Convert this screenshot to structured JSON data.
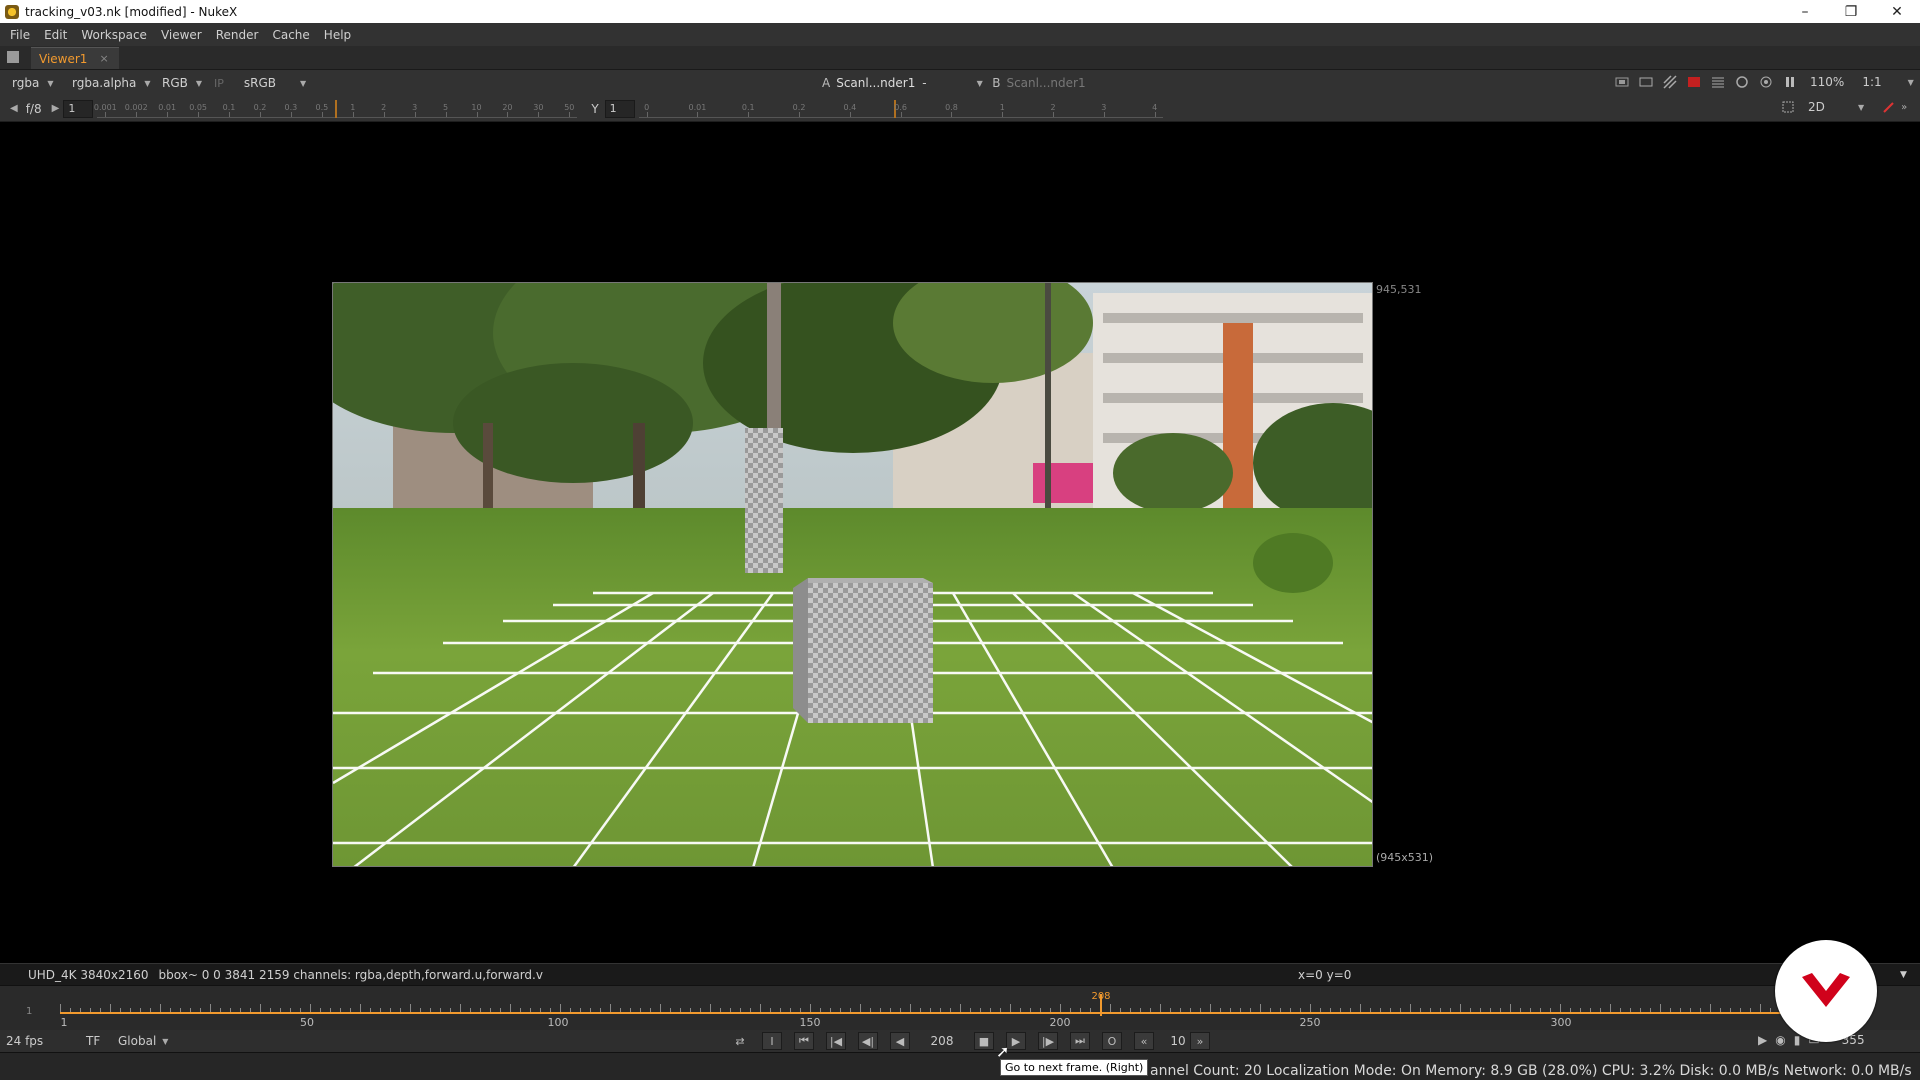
{
  "window": {
    "title": "tracking_v03.nk [modified] - NukeX",
    "controls": [
      "–",
      "❐",
      "✕"
    ]
  },
  "menu": [
    "File",
    "Edit",
    "Workspace",
    "Viewer",
    "Render",
    "Cache",
    "Help"
  ],
  "tabs": [
    {
      "label": "Viewer1",
      "close": "×"
    }
  ],
  "viewer_toolbar": {
    "channels": "rgba",
    "alpha": "rgba.alpha",
    "display": "RGB",
    "ip": "IP",
    "lut": "sRGB",
    "input_a_label": "A",
    "input_a": "Scanl...nder1",
    "blend": "-",
    "input_b_label": "B",
    "input_b": "Scanl...nder1",
    "zoom": "110%",
    "ratio": "1:1"
  },
  "viewer_toolbar2": {
    "fstop": "f/8",
    "gain": "1",
    "gamma_label": "Y",
    "gamma": "1",
    "gain_ticks": [
      "0.001",
      "0.002",
      "0.01",
      "0.05",
      "0.1",
      "0.2",
      "0.3",
      "0.5",
      "1",
      "2",
      "3",
      "5",
      "10",
      "20",
      "30",
      "50"
    ],
    "gamma_ticks": [
      "0",
      "0.01",
      "0.1",
      "0.2",
      "0.4",
      "0.6",
      "0.8",
      "1",
      "2",
      "3",
      "4"
    ],
    "view_mode": "2D"
  },
  "viewer": {
    "res_top": "945,531",
    "res_bottom": "(945x531)"
  },
  "info": {
    "format": "UHD_4K 3840x2160",
    "bbox": "bbox~ 0 0 3841 2159 channels: rgba,depth,forward.u,forward.v",
    "coords": "x=0 y=0"
  },
  "timeline": {
    "in_point": "1",
    "labels": [
      "1",
      "50",
      "100",
      "150",
      "200",
      "250",
      "300"
    ],
    "current_frame": "208",
    "end_frame": "355"
  },
  "playback": {
    "fps": "24 fps",
    "tf": "TF",
    "scope": "Global",
    "frame": "208",
    "increment": "10",
    "end": "355"
  },
  "tooltip": "Go to next frame. (Right)",
  "status": "annel Count: 20 Localization Mode: On Memory: 8.9 GB (28.0%) CPU: 3.2% Disk: 0.0 MB/s Network: 0.0 MB/s",
  "colors": {
    "accent": "#f29a2e",
    "logo": "#d0021b"
  }
}
